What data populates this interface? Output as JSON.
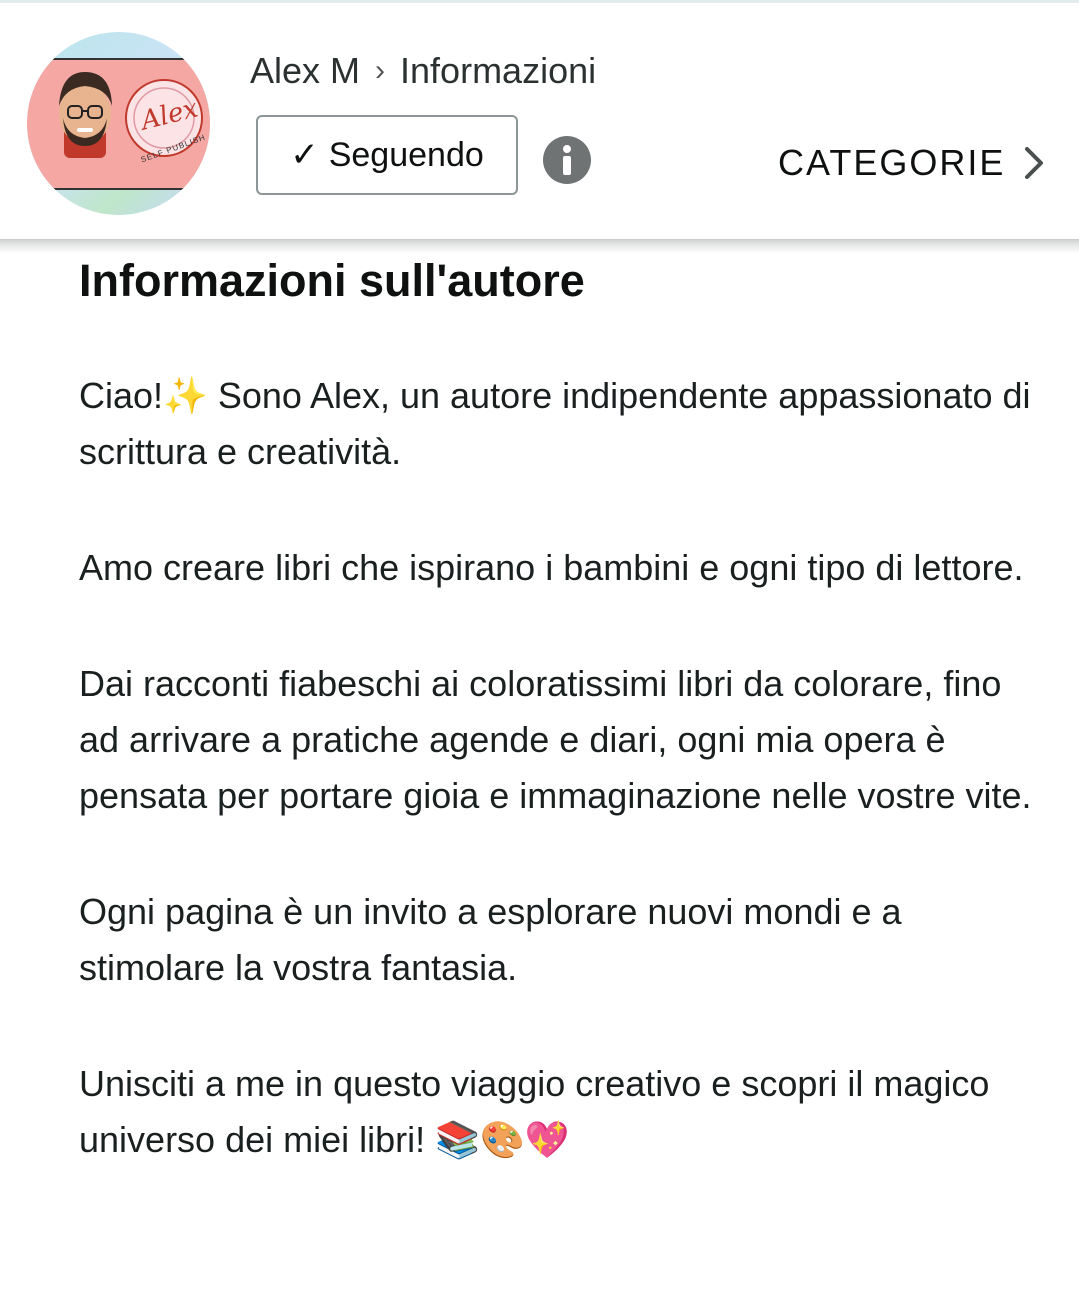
{
  "header": {
    "breadcrumb": {
      "author": "Alex M",
      "separator": "›",
      "page": "Informazioni"
    },
    "follow_button": {
      "check": "✓",
      "label": "Seguendo"
    },
    "info_icon": "info-icon",
    "categories_link": "CATEGORIE",
    "avatar_logo": {
      "script": "Alex",
      "ring_text": "SELF PUBLISH"
    }
  },
  "main": {
    "title": "Informazioni sull'autore",
    "paragraphs": [
      "Ciao!✨ Sono Alex, un autore indipendente appassionato di scrittura e creatività.",
      "Amo creare libri che ispirano i bambini e ogni tipo di lettore.",
      "Dai racconti fiabeschi ai coloratissimi libri da colorare, fino ad arrivare a pratiche agende e diari, ogni mia opera è pensata per portare gioia e immaginazione nelle vostre vite.",
      "Ogni pagina è un invito a esplorare nuovi mondi e a stimolare la vostra fantasia.",
      "Unisciti a me in questo viaggio creativo e scopri il magico universo dei miei libri! 📚🎨💖"
    ]
  },
  "colors": {
    "avatar_band": "#f4a7a3",
    "info_icon": "#6f7373",
    "button_border": "#8d9696"
  }
}
